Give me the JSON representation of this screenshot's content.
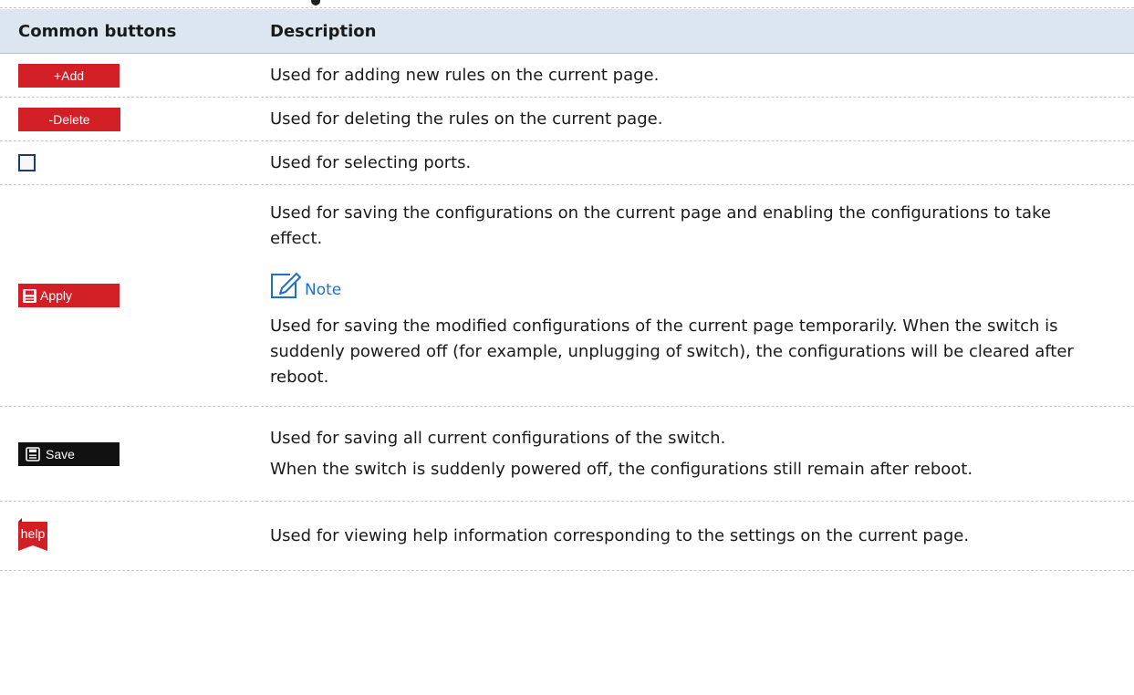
{
  "table": {
    "headers": {
      "col1": "Common buttons",
      "col2": "Description"
    },
    "rows": {
      "add": {
        "button_label": "+Add",
        "desc": "Used for adding new rules on the current page."
      },
      "delete": {
        "button_label": "-Delete",
        "desc": "Used for deleting the rules on the current page."
      },
      "checkbox": {
        "desc": "Used for selecting ports."
      },
      "apply": {
        "button_label": "Apply",
        "desc": "Used for saving the configurations on the current page and enabling the configurations to take effect.",
        "note_label": "Note",
        "note_text": "Used for saving the modified configurations of the current page temporarily. When the switch is suddenly powered off (for example, unplugging of switch), the configurations will be cleared after reboot."
      },
      "save": {
        "button_label": "Save",
        "desc1": "Used for saving all current configurations of the switch.",
        "desc2": "When the switch is suddenly powered off, the configurations still remain after reboot."
      },
      "help": {
        "button_label": "help",
        "desc": "Used for viewing help information corresponding to the settings on the current page."
      }
    }
  },
  "colors": {
    "header_bg": "#dce6f0",
    "button_red": "#d21f26",
    "button_black": "#111111",
    "note_blue": "#1f6fd1"
  },
  "icons": {
    "apply_icon": "save-floppy-icon",
    "save_icon": "save-floppy-icon",
    "note_icon": "edit-note-icon",
    "help_icon": "help-tab-icon"
  }
}
